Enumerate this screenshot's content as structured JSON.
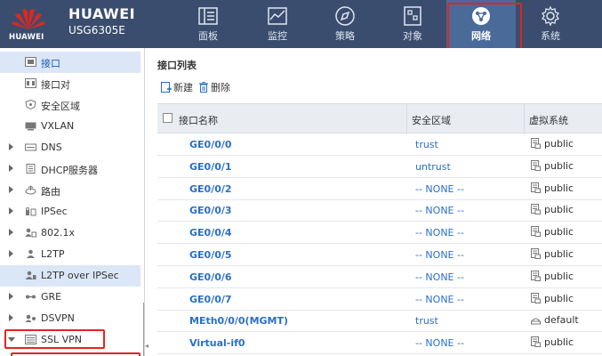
{
  "header": {
    "logo_text": "HUAWEI",
    "brand": "HUAWEI",
    "model": "USG6305E",
    "nav": [
      {
        "label": "面板",
        "icon": "dashboard-icon"
      },
      {
        "label": "监控",
        "icon": "monitor-icon"
      },
      {
        "label": "策略",
        "icon": "policy-icon"
      },
      {
        "label": "对象",
        "icon": "object-icon"
      },
      {
        "label": "网络",
        "icon": "network-icon",
        "active": true
      },
      {
        "label": "系统",
        "icon": "gear-icon"
      }
    ]
  },
  "sidebar": {
    "items": [
      {
        "label": "接口",
        "icon": "interface-icon",
        "selected": true
      },
      {
        "label": "接口对",
        "icon": "interface-pair-icon"
      },
      {
        "label": "安全区域",
        "icon": "security-zone-icon"
      },
      {
        "label": "VXLAN",
        "icon": "vxlan-icon"
      },
      {
        "label": "DNS",
        "icon": "dns-icon",
        "expandable": true
      },
      {
        "label": "DHCP服务器",
        "icon": "dhcp-icon",
        "expandable": true
      },
      {
        "label": "路由",
        "icon": "route-icon",
        "expandable": true
      },
      {
        "label": "IPSec",
        "icon": "ipsec-icon",
        "expandable": true
      },
      {
        "label": "802.1x",
        "icon": "dot1x-icon",
        "expandable": true
      },
      {
        "label": "L2TP",
        "icon": "l2tp-icon",
        "expandable": true
      },
      {
        "label": "L2TP over IPSec",
        "icon": "l2tp-ipsec-icon",
        "highlight": true
      },
      {
        "label": "GRE",
        "icon": "gre-icon",
        "expandable": true
      },
      {
        "label": "DSVPN",
        "icon": "dsvpn-icon",
        "expandable": true
      },
      {
        "label": "SSL VPN",
        "icon": "ssl-vpn-icon",
        "expanded": true
      }
    ]
  },
  "main": {
    "title": "接口列表",
    "toolbar": {
      "new_label": "新建",
      "delete_label": "删除"
    },
    "columns": {
      "name": "接口名称",
      "zone": "安全区域",
      "vsys": "虚拟系统"
    },
    "rows": [
      {
        "name": "GE0/0/0",
        "zone": "trust",
        "vsys": "public"
      },
      {
        "name": "GE0/0/1",
        "zone": "untrust",
        "vsys": "public"
      },
      {
        "name": "GE0/0/2",
        "zone": "-- NONE --",
        "vsys": "public"
      },
      {
        "name": "GE0/0/3",
        "zone": "-- NONE --",
        "vsys": "public"
      },
      {
        "name": "GE0/0/4",
        "zone": "-- NONE --",
        "vsys": "public"
      },
      {
        "name": "GE0/0/5",
        "zone": "-- NONE --",
        "vsys": "public"
      },
      {
        "name": "GE0/0/6",
        "zone": "-- NONE --",
        "vsys": "public"
      },
      {
        "name": "GE0/0/7",
        "zone": "-- NONE --",
        "vsys": "public"
      },
      {
        "name": "MEth0/0/0(MGMT)",
        "zone": "trust",
        "vsys": "default"
      },
      {
        "name": "Virtual-if0",
        "zone": "-- NONE --",
        "vsys": "public"
      }
    ]
  },
  "colors": {
    "topbar": "#3a4d6e",
    "accent": "#e0261f",
    "link": "#2a6fc9"
  }
}
